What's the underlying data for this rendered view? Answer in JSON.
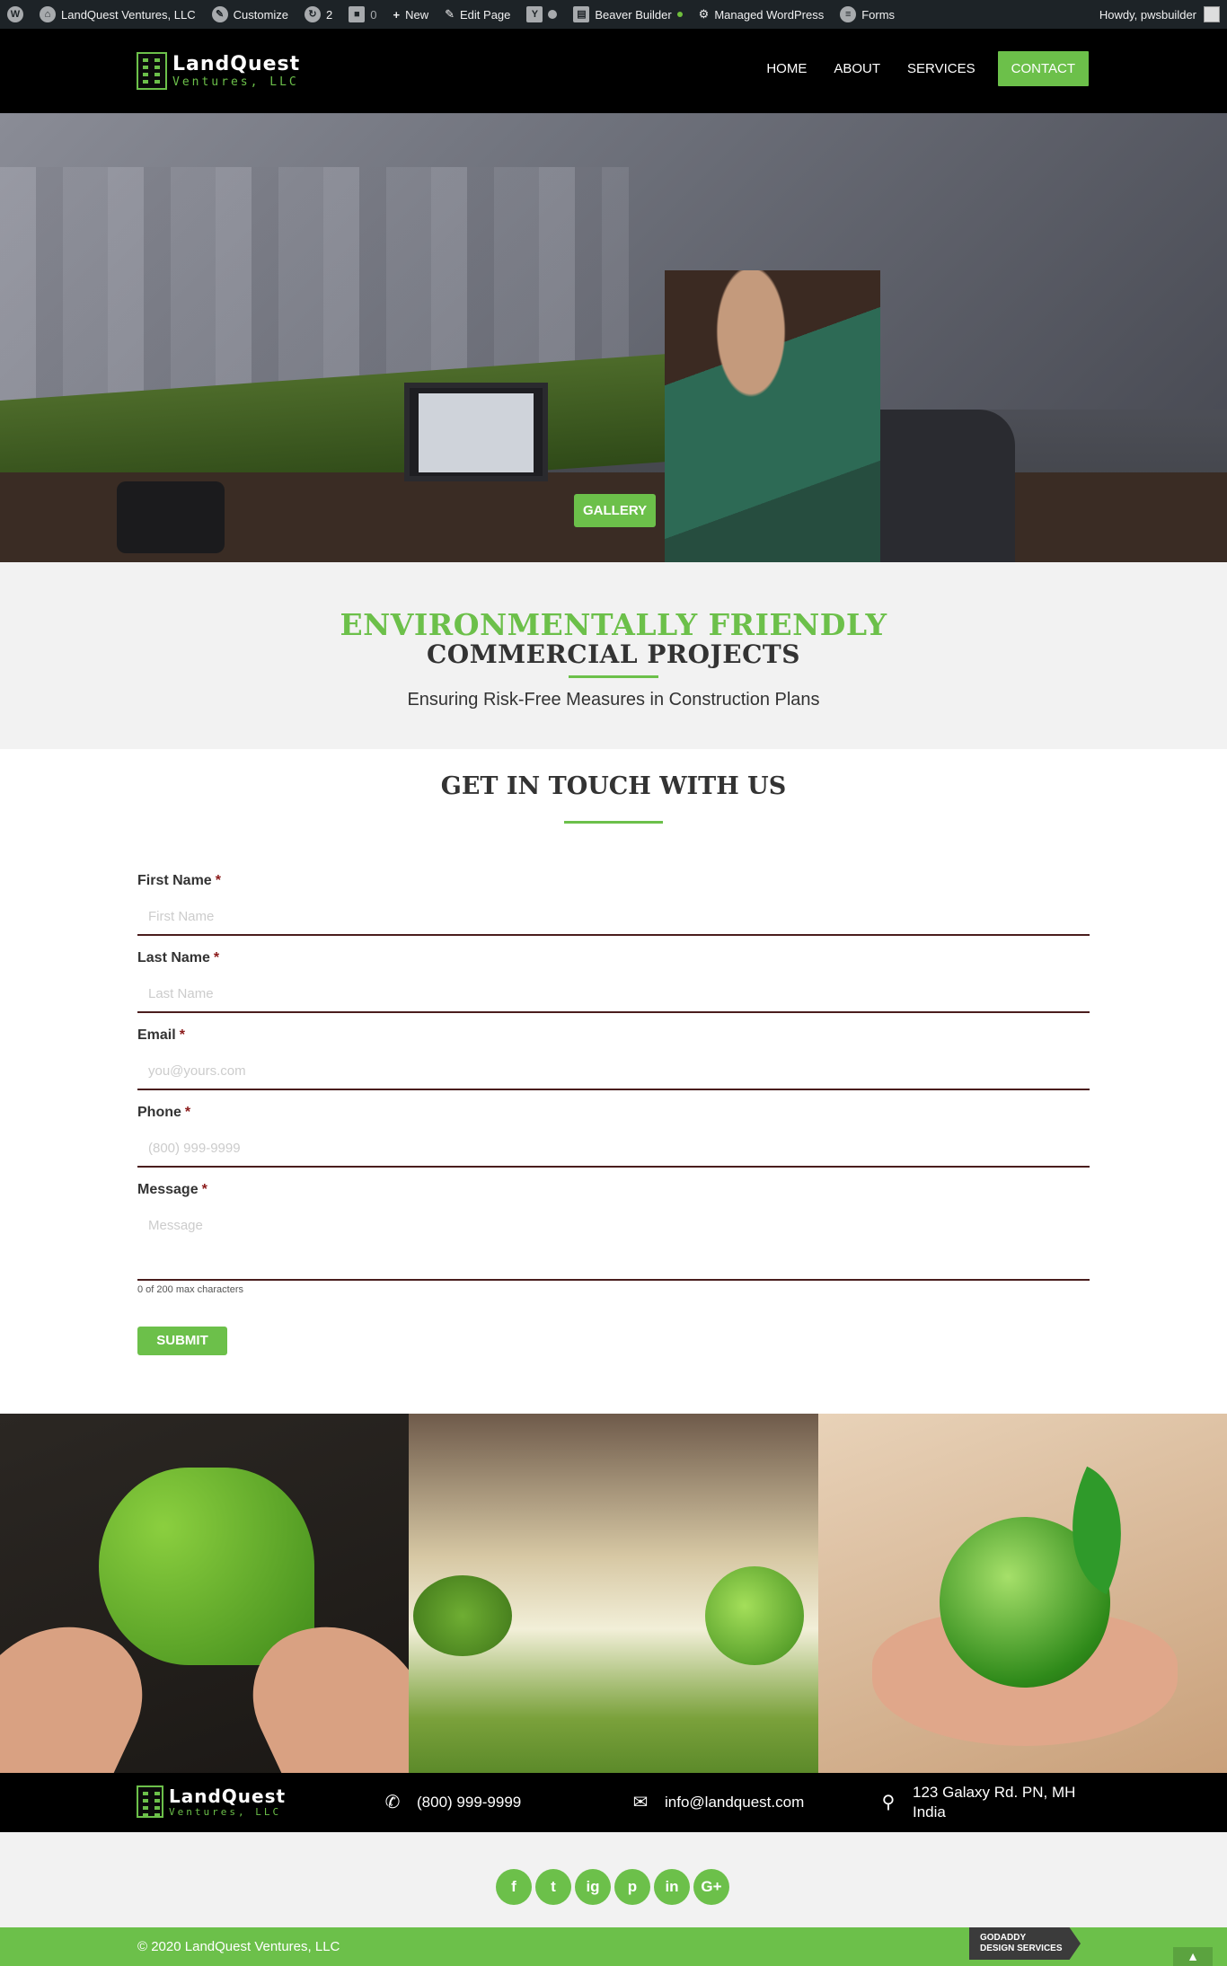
{
  "adminbar": {
    "site_name": "LandQuest Ventures, LLC",
    "customize": "Customize",
    "updates_count": "2",
    "comments_count": "0",
    "new": "New",
    "edit_page": "Edit Page",
    "beaver_builder": "Beaver Builder",
    "managed_wp": "Managed WordPress",
    "forms": "Forms",
    "howdy": "Howdy, pwsbuilder"
  },
  "logo": {
    "main": "LandQuest",
    "sub": "Ventures, LLC"
  },
  "nav": {
    "home": "HOME",
    "about": "ABOUT",
    "services": "SERVICES",
    "contact": "CONTACT"
  },
  "hero": {
    "gallery_button": "GALLERY"
  },
  "intro": {
    "title_green": "ENVIRONMENTALLY FRIENDLY",
    "title_dark": "COMMERCIAL PROJECTS",
    "subtitle": "Ensuring Risk-Free Measures in Construction Plans"
  },
  "contact": {
    "heading": "GET IN TOUCH WITH US",
    "required_mark": "*",
    "fields": [
      {
        "label": "First Name",
        "placeholder": "First Name"
      },
      {
        "label": "Last Name",
        "placeholder": "Last Name"
      },
      {
        "label": "Email",
        "placeholder": "you@yours.com"
      },
      {
        "label": "Phone",
        "placeholder": "(800) 999-9999"
      },
      {
        "label": "Message",
        "placeholder": "Message"
      }
    ],
    "char_count": "0 of 200 max characters",
    "submit": "SUBMIT"
  },
  "footer": {
    "phone": "(800) 999-9999",
    "email": "info@landquest.com",
    "address_line1": "123 Galaxy Rd. PN, MH",
    "address_line2": "India",
    "social": [
      "f",
      "t",
      "ig",
      "p",
      "in",
      "G+"
    ],
    "copyright": "© 2020 LandQuest Ventures, LLC",
    "badge_line1": "GODADDY",
    "badge_line2": "DESIGN SERVICES"
  },
  "colors": {
    "accent": "#6cc04a",
    "dark": "#000000",
    "admin": "#1d2327"
  }
}
